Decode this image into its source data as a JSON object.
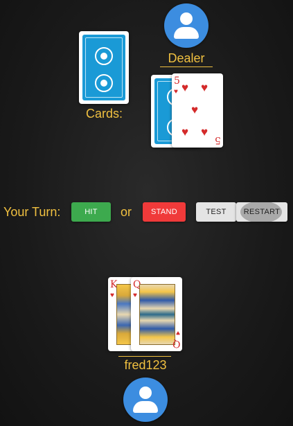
{
  "dealer": {
    "name": "Dealer",
    "cards_label": "Cards:",
    "face_card": {
      "rank": "5",
      "suit": "♥"
    }
  },
  "controls": {
    "turn_label": "Your Turn:",
    "hit_label": "HIT",
    "or_label": "or",
    "stand_label": "STAND",
    "test_label": "TEST",
    "restart_label": "RESTART"
  },
  "player": {
    "name": "fred123",
    "cards": [
      {
        "rank": "K",
        "suit": "♥"
      },
      {
        "rank": "Q",
        "suit": "♥"
      }
    ]
  },
  "colors": {
    "accent": "#f0c040",
    "hit": "#3daa4e",
    "stand": "#f03a3a",
    "avatar": "#3c8de0",
    "card_back": "#1a9ad6"
  }
}
